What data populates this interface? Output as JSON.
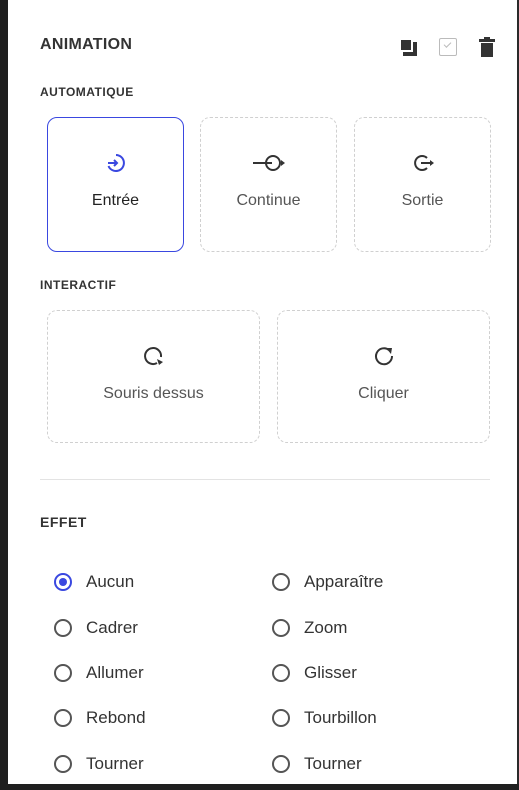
{
  "panel": {
    "title": "ANIMATION",
    "header_icons": [
      "copy-icon",
      "checkbox-icon",
      "trash-icon"
    ]
  },
  "automatique": {
    "label": "AUTOMATIQUE",
    "cards": [
      {
        "label": "Entrée",
        "icon": "enter-icon",
        "active": true
      },
      {
        "label": "Continue",
        "icon": "continue-icon",
        "active": false
      },
      {
        "label": "Sortie",
        "icon": "exit-icon",
        "active": false
      }
    ]
  },
  "interactif": {
    "label": "INTERACTIF",
    "cards": [
      {
        "label": "Souris dessus",
        "icon": "hover-icon",
        "active": false
      },
      {
        "label": "Cliquer",
        "icon": "click-icon",
        "active": false
      }
    ]
  },
  "effet": {
    "label": "EFFET",
    "options_left": [
      {
        "label": "Aucun",
        "checked": true
      },
      {
        "label": "Cadrer",
        "checked": false
      },
      {
        "label": "Allumer",
        "checked": false
      },
      {
        "label": "Rebond",
        "checked": false
      },
      {
        "label": "Tourner",
        "checked": false
      }
    ],
    "options_right": [
      {
        "label": "Apparaître",
        "checked": false
      },
      {
        "label": "Zoom",
        "checked": false
      },
      {
        "label": "Glisser",
        "checked": false
      },
      {
        "label": "Tourbillon",
        "checked": false
      },
      {
        "label": "Tourner",
        "checked": false
      }
    ]
  },
  "colors": {
    "accent": "#3a48e0",
    "text": "#333333",
    "dashed_border": "#d0d0d0"
  }
}
